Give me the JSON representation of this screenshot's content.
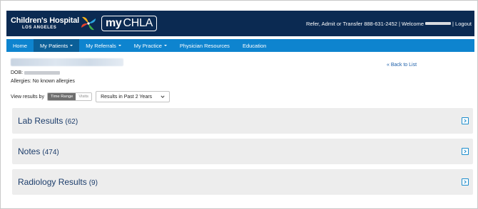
{
  "header": {
    "brand_line1": "Children's Hospital",
    "brand_line2": "LOS ANGELES",
    "portal_my": "my",
    "portal_name": "CHLA",
    "refer_text": "Refer, Admit or Transfer 888-631-2452",
    "separator": "|",
    "welcome_text": "Welcome",
    "logout_label": "| Logout"
  },
  "nav": {
    "items": [
      {
        "label": "Home"
      },
      {
        "label": "My Patients"
      },
      {
        "label": "My Referrals"
      },
      {
        "label": "My Practice"
      },
      {
        "label": "Physician Resources"
      },
      {
        "label": "Education"
      }
    ]
  },
  "patient": {
    "dob_label": "DOB:",
    "allergies": "Allergies: No known allergies"
  },
  "back_link": "« Back to List",
  "view": {
    "label": "View results by",
    "toggle_time": "Time Range",
    "toggle_visits": "Visits",
    "range_selected": "Results in Past 2 Years"
  },
  "panels": [
    {
      "title": "Lab Results",
      "count": "(62)"
    },
    {
      "title": "Notes",
      "count": "(474)"
    },
    {
      "title": "Radiology Results",
      "count": "(9)"
    }
  ],
  "colors": {
    "header_bg": "#0b2a52",
    "nav_bg": "#0e84cf",
    "nav_active_bg": "#0b5f98",
    "panel_bg": "#ededed",
    "panel_text": "#1c3d6b",
    "link": "#1b5ea8"
  },
  "icons": {
    "logo": "pinwheel-logo-icon",
    "dropdown": "chevron-down-icon",
    "expand": "expand-arrow-icon"
  }
}
